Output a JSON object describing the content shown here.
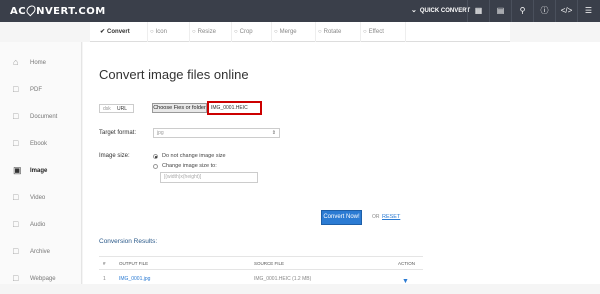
{
  "header": {
    "logo_text_left": "AC",
    "logo_text_right": "NVERT.COM",
    "quick_convert": "QUICK CONVERT",
    "icons": [
      "grid-icon",
      "layers-icon",
      "search-icon",
      "help-icon",
      "code-icon",
      "menu-icon"
    ]
  },
  "tabs": [
    {
      "label": "Convert",
      "icon": "check-icon",
      "active": true
    },
    {
      "label": "Icon"
    },
    {
      "label": "Resize"
    },
    {
      "label": "Crop"
    },
    {
      "label": "Merge"
    },
    {
      "label": "Rotate"
    },
    {
      "label": "Effect"
    }
  ],
  "sidebar": {
    "items": [
      {
        "label": "Home",
        "icon": "home-icon"
      },
      {
        "label": "PDF",
        "icon": "pdf-icon"
      },
      {
        "label": "Document",
        "icon": "document-icon"
      },
      {
        "label": "Ebook",
        "icon": "ebook-icon"
      },
      {
        "label": "Image",
        "icon": "image-icon",
        "active": true
      },
      {
        "label": "Video",
        "icon": "video-icon"
      },
      {
        "label": "Audio",
        "icon": "audio-icon"
      },
      {
        "label": "Archive",
        "icon": "archive-icon"
      },
      {
        "label": "Webpage",
        "icon": "webpage-icon"
      }
    ]
  },
  "main": {
    "title": "Convert image files online",
    "source_toggle": {
      "left": "dsk",
      "right": "URL"
    },
    "file_button": "Choose Fies or folder",
    "file_name": "IMG_0001.HEIC",
    "target_format_label": "Target format:",
    "target_format_value": "jpg",
    "image_size_label": "Image size:",
    "size_option_1": "Do not change image size",
    "size_option_2": "Change image size to:",
    "dims_placeholder": "[(width)x(height)]",
    "convert_button": "Convert Now!",
    "or_text": "OR",
    "reset_link": "RESET",
    "results_title": "Conversion Results:",
    "table_headers": [
      "#",
      "OUTPUT FILE",
      "SOURCE FILE",
      "ACTION"
    ],
    "table_rows": [
      {
        "num": "1",
        "output": "IMG_0001.jpg",
        "source": "IMG_0001.HEIC (1.2 MB)"
      }
    ]
  },
  "colors": {
    "accent": "#2b7bd3",
    "topbar": "#3a3f4a",
    "highlight": "#cc0000"
  }
}
